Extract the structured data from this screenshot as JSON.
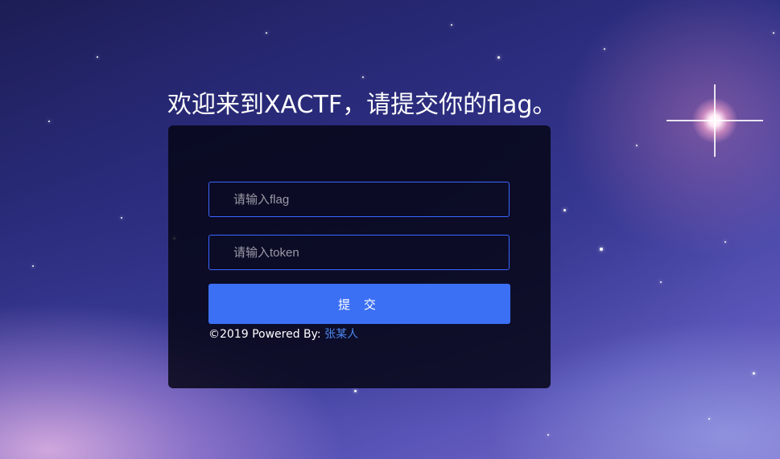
{
  "page": {
    "heading": "欢迎来到XACTF，请提交你的flag。"
  },
  "form": {
    "flag_placeholder": "请输入flag",
    "flag_value": "",
    "token_placeholder": "请输入token",
    "token_value": "",
    "submit_label": "提 交"
  },
  "footer": {
    "text": "©2019 Powered By: ",
    "author": "张某人"
  },
  "colors": {
    "accent": "#3b70f5",
    "input_border": "#3a66ff",
    "link": "#4b86f0",
    "panel": "#06061a"
  },
  "background": {
    "icon": "starry-sky-background"
  }
}
